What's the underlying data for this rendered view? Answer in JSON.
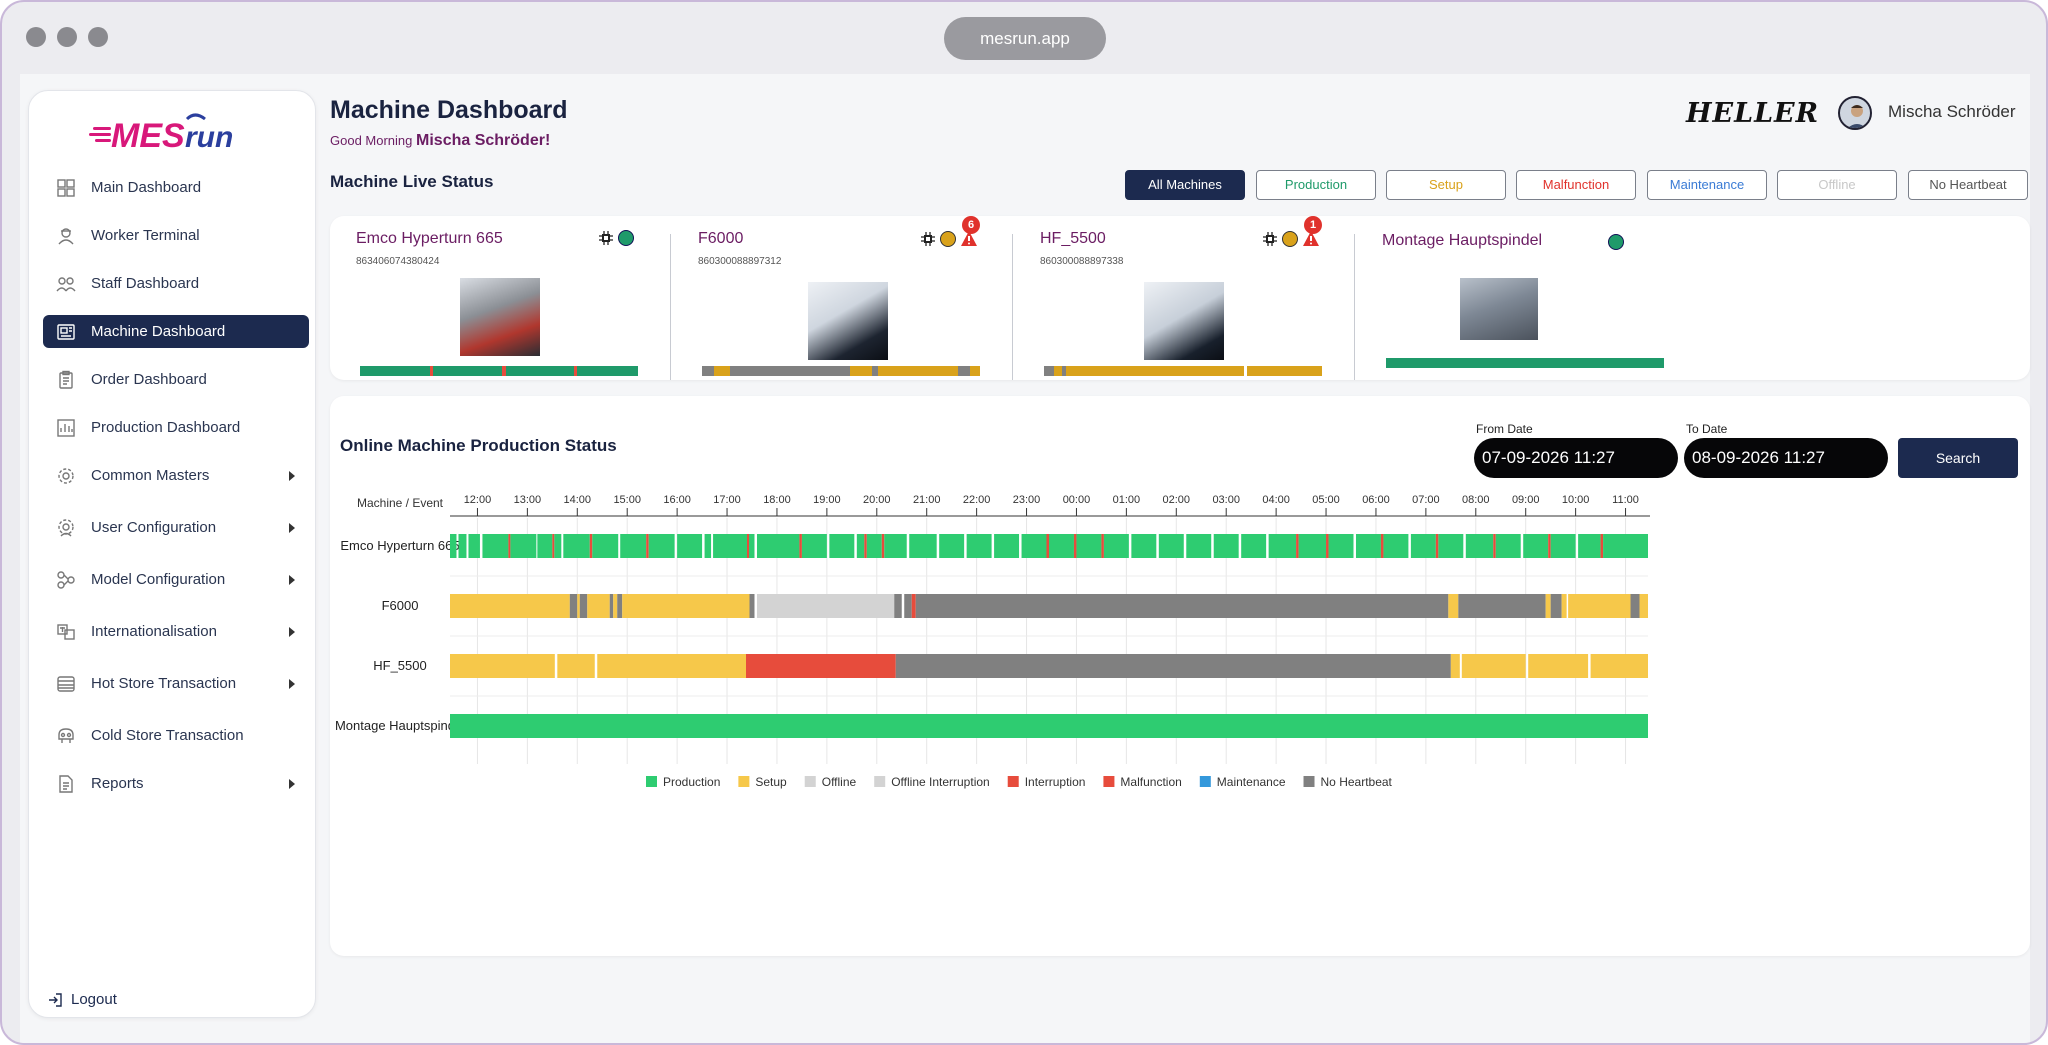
{
  "browser": {
    "url": "mesrun.app"
  },
  "sidebar": {
    "logo_text": "MESrun",
    "items": [
      {
        "label": "Main Dashboard",
        "icon": "grid-icon",
        "active": false,
        "has_submenu": false
      },
      {
        "label": "Worker Terminal",
        "icon": "worker-icon",
        "active": false,
        "has_submenu": false
      },
      {
        "label": "Staff Dashboard",
        "icon": "staff-icon",
        "active": false,
        "has_submenu": false
      },
      {
        "label": "Machine Dashboard",
        "icon": "machine-icon",
        "active": true,
        "has_submenu": false
      },
      {
        "label": "Order Dashboard",
        "icon": "clipboard-icon",
        "active": false,
        "has_submenu": false
      },
      {
        "label": "Production Dashboard",
        "icon": "chart-icon",
        "active": false,
        "has_submenu": false
      },
      {
        "label": "Common Masters",
        "icon": "gear-icon",
        "active": false,
        "has_submenu": true
      },
      {
        "label": "User Configuration",
        "icon": "user-gear-icon",
        "active": false,
        "has_submenu": true
      },
      {
        "label": "Model Configuration",
        "icon": "model-icon",
        "active": false,
        "has_submenu": true
      },
      {
        "label": "Internationalisation",
        "icon": "translate-icon",
        "active": false,
        "has_submenu": true
      },
      {
        "label": "Hot Store Transaction",
        "icon": "store-icon",
        "active": false,
        "has_submenu": true
      },
      {
        "label": "Cold Store Transaction",
        "icon": "cold-store-icon",
        "active": false,
        "has_submenu": false
      },
      {
        "label": "Reports",
        "icon": "report-icon",
        "active": false,
        "has_submenu": true
      }
    ],
    "logout_label": "Logout"
  },
  "header": {
    "title": "Machine Dashboard",
    "greeting_prefix": "Good Morning",
    "greeting_name": "Mischa Schröder!",
    "brand": "HELLER",
    "user_name": "Mischa Schröder"
  },
  "live_status": {
    "title": "Machine Live Status",
    "filters": [
      {
        "label": "All Machines",
        "color": "#ffffff",
        "active": true
      },
      {
        "label": "Production",
        "color": "#1f9a6a",
        "active": false
      },
      {
        "label": "Setup",
        "color": "#d9a21b",
        "active": false
      },
      {
        "label": "Malfunction",
        "color": "#e0322c",
        "active": false
      },
      {
        "label": "Maintenance",
        "color": "#3a7bd5",
        "active": false
      },
      {
        "label": "Offline",
        "color": "#c8c8c8",
        "active": false
      },
      {
        "label": "No Heartbeat",
        "color": "#555555",
        "active": false
      }
    ],
    "machines": [
      {
        "name": "Emco Hyperturn 665",
        "serial": "863406074380424",
        "status_color": "#1f9a6a",
        "chip": true,
        "alert_count": null
      },
      {
        "name": "F6000",
        "serial": "860300088897312",
        "status_color": "#d9a21b",
        "chip": true,
        "alert_count": "6"
      },
      {
        "name": "HF_5500",
        "serial": "860300088897338",
        "status_color": "#d9a21b",
        "chip": true,
        "alert_count": "1"
      },
      {
        "name": "Montage Hauptspindel",
        "serial": "",
        "status_color": "#1f9a6a",
        "chip": false,
        "alert_count": null
      }
    ]
  },
  "production": {
    "title": "Online Machine Production Status",
    "from_label": "From Date",
    "from_value": "07-09-2026 11:27",
    "to_label": "To Date",
    "to_value": "08-09-2026 11:27",
    "search_label": "Search"
  },
  "colors": {
    "Production": "#2ecc71",
    "Setup": "#f6c84a",
    "Offline": "#d3d3d3",
    "Offline Interruption": "#d3d3d3",
    "Interruption": "#e74c3c",
    "Malfunction": "#e74c3c",
    "Maintenance": "#3498db",
    "No Heartbeat": "#808080"
  },
  "chart_data": {
    "type": "timeline",
    "y_header": "Machine / Event",
    "x_ticks": [
      "12:00",
      "13:00",
      "14:00",
      "15:00",
      "16:00",
      "17:00",
      "18:00",
      "19:00",
      "20:00",
      "21:00",
      "22:00",
      "23:00",
      "00:00",
      "01:00",
      "02:00",
      "03:00",
      "04:00",
      "05:00",
      "06:00",
      "07:00",
      "08:00",
      "09:00",
      "10:00",
      "11:00"
    ],
    "x_range": [
      "11:27",
      "11:27"
    ],
    "rows": [
      {
        "machine": "Emco Hyperturn 665",
        "segments": [
          [
            "Production",
            11.45,
            11.58
          ],
          [
            "Production",
            11.62,
            11.78
          ],
          [
            "Production",
            11.82,
            12.05
          ],
          [
            "Production",
            12.1,
            12.62
          ],
          [
            "Interruption",
            12.62,
            12.66
          ],
          [
            "Production",
            12.66,
            13.18
          ],
          [
            "Production",
            13.2,
            13.5
          ],
          [
            "Interruption",
            13.5,
            13.54
          ],
          [
            "Production",
            13.54,
            13.68
          ],
          [
            "Production",
            13.72,
            14.25
          ],
          [
            "Interruption",
            14.25,
            14.3
          ],
          [
            "Production",
            14.3,
            14.82
          ],
          [
            "Production",
            14.86,
            15.38
          ],
          [
            "Interruption",
            15.38,
            15.43
          ],
          [
            "Production",
            15.43,
            15.95
          ],
          [
            "Production",
            16.0,
            16.5
          ],
          [
            "Production",
            16.55,
            16.68
          ],
          [
            "Production",
            16.72,
            17.4
          ],
          [
            "Interruption",
            17.4,
            17.44
          ],
          [
            "Production",
            17.44,
            17.55
          ],
          [
            "Production",
            17.6,
            18.45
          ],
          [
            "Interruption",
            18.45,
            18.5
          ],
          [
            "Production",
            18.5,
            19.0
          ],
          [
            "Production",
            19.05,
            19.55
          ],
          [
            "Production",
            19.6,
            19.75
          ],
          [
            "Interruption",
            19.75,
            19.8
          ],
          [
            "Production",
            19.8,
            20.1
          ],
          [
            "Interruption",
            20.1,
            20.15
          ],
          [
            "Production",
            20.15,
            20.6
          ],
          [
            "Production",
            20.65,
            21.2
          ],
          [
            "Production",
            21.25,
            21.75
          ],
          [
            "Production",
            21.8,
            22.3
          ],
          [
            "Production",
            22.35,
            22.85
          ],
          [
            "Production",
            22.9,
            23.4
          ],
          [
            "Interruption",
            23.4,
            23.45
          ],
          [
            "Production",
            23.45,
            23.95
          ],
          [
            "Interruption",
            23.95,
            24.0
          ],
          [
            "Production",
            24.0,
            24.5
          ],
          [
            "Interruption",
            24.5,
            24.55
          ],
          [
            "Production",
            24.55,
            25.05
          ],
          [
            "Production",
            25.1,
            25.6
          ],
          [
            "Production",
            25.65,
            26.15
          ],
          [
            "Production",
            26.2,
            26.7
          ],
          [
            "Production",
            26.75,
            27.25
          ],
          [
            "Production",
            27.3,
            27.8
          ],
          [
            "Production",
            27.85,
            28.4
          ],
          [
            "Interruption",
            28.4,
            28.45
          ],
          [
            "Production",
            28.45,
            29.0
          ],
          [
            "Interruption",
            29.0,
            29.05
          ],
          [
            "Production",
            29.05,
            29.55
          ],
          [
            "Production",
            29.6,
            30.1
          ],
          [
            "Interruption",
            30.1,
            30.15
          ],
          [
            "Production",
            30.15,
            30.65
          ],
          [
            "Production",
            30.7,
            31.2
          ],
          [
            "Interruption",
            31.2,
            31.25
          ],
          [
            "Production",
            31.25,
            31.75
          ],
          [
            "Production",
            31.8,
            32.35
          ],
          [
            "Interruption",
            32.35,
            32.4
          ],
          [
            "Production",
            32.4,
            32.9
          ],
          [
            "Production",
            32.95,
            33.45
          ],
          [
            "Interruption",
            33.45,
            33.5
          ],
          [
            "Production",
            33.5,
            34.0
          ],
          [
            "Production",
            34.05,
            34.5
          ],
          [
            "Interruption",
            34.5,
            34.55
          ],
          [
            "Production",
            34.55,
            35.45
          ]
        ]
      },
      {
        "machine": "F6000",
        "segments": [
          [
            "Setup",
            11.45,
            13.85
          ],
          [
            "No Heartbeat",
            13.85,
            14.0
          ],
          [
            "Setup",
            14.0,
            14.05
          ],
          [
            "No Heartbeat",
            14.05,
            14.2
          ],
          [
            "Setup",
            14.2,
            14.65
          ],
          [
            "No Heartbeat",
            14.65,
            14.72
          ],
          [
            "Setup",
            14.72,
            14.8
          ],
          [
            "No Heartbeat",
            14.8,
            14.9
          ],
          [
            "Setup",
            14.9,
            17.45
          ],
          [
            "No Heartbeat",
            17.45,
            17.55
          ],
          [
            "Offline",
            17.6,
            20.35
          ],
          [
            "No Heartbeat",
            20.35,
            20.5
          ],
          [
            "No Heartbeat",
            20.55,
            20.7
          ],
          [
            "Interruption",
            20.7,
            20.78
          ],
          [
            "No Heartbeat",
            20.78,
            31.45
          ],
          [
            "Setup",
            31.45,
            31.65
          ],
          [
            "No Heartbeat",
            31.65,
            33.4
          ],
          [
            "Setup",
            33.4,
            33.5
          ],
          [
            "No Heartbeat",
            33.5,
            33.72
          ],
          [
            "Setup",
            33.72,
            33.82
          ],
          [
            "Setup",
            33.85,
            35.1
          ],
          [
            "No Heartbeat",
            35.1,
            35.28
          ],
          [
            "Setup",
            35.28,
            35.45
          ]
        ]
      },
      {
        "machine": "HF_5500",
        "segments": [
          [
            "Setup",
            11.45,
            13.55
          ],
          [
            "Setup",
            13.6,
            14.35
          ],
          [
            "Setup",
            14.4,
            17.38
          ],
          [
            "Malfunction",
            17.38,
            20.38
          ],
          [
            "No Heartbeat",
            20.38,
            31.5
          ],
          [
            "Setup",
            31.5,
            31.68
          ],
          [
            "Setup",
            31.72,
            33.0
          ],
          [
            "Setup",
            33.05,
            34.25
          ],
          [
            "Setup",
            34.3,
            35.45
          ]
        ]
      },
      {
        "machine": "Montage Hauptspindel",
        "segments": [
          [
            "Production",
            11.45,
            35.45
          ]
        ]
      }
    ],
    "legend": [
      "Production",
      "Setup",
      "Offline",
      "Offline Interruption",
      "Interruption",
      "Malfunction",
      "Maintenance",
      "No Heartbeat"
    ]
  }
}
